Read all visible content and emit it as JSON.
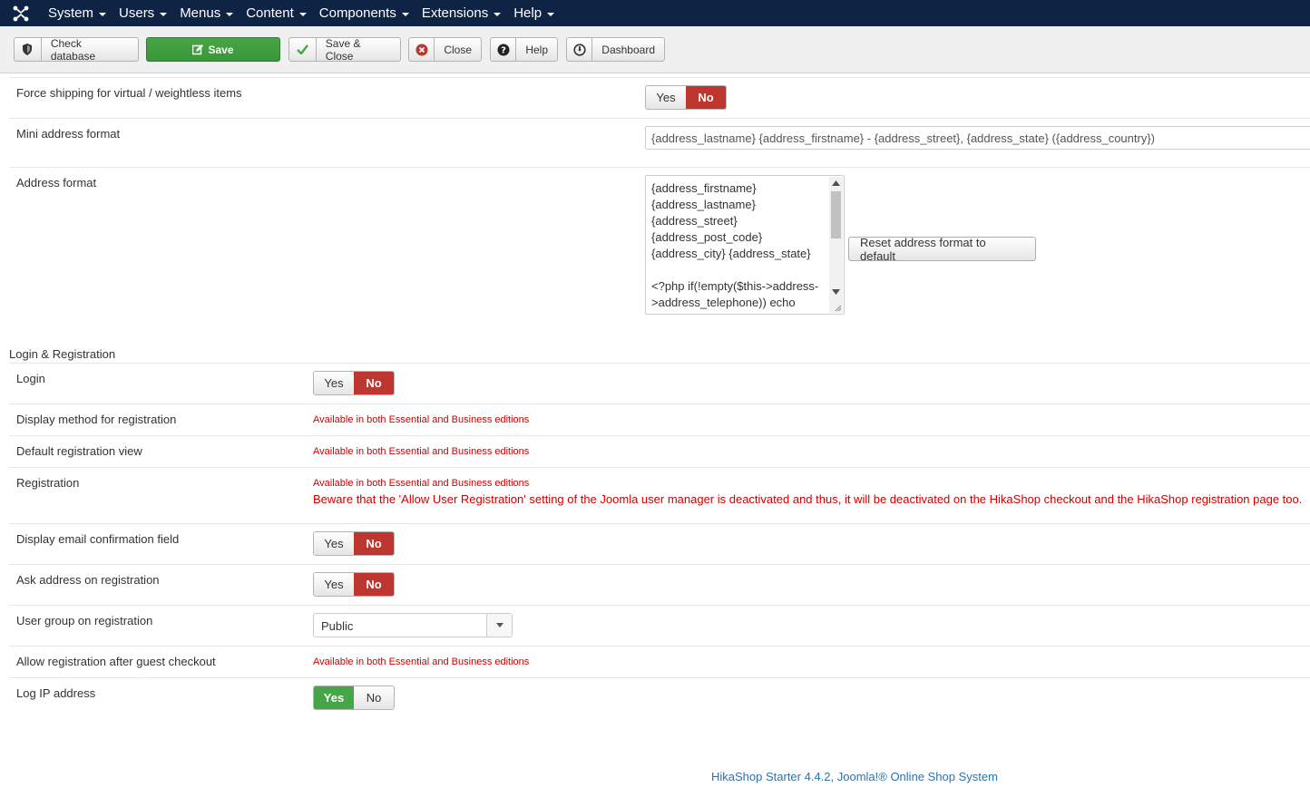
{
  "navbar": {
    "logo_icon": "joomla-logo-icon",
    "items": [
      {
        "label": "System"
      },
      {
        "label": "Users"
      },
      {
        "label": "Menus"
      },
      {
        "label": "Content"
      },
      {
        "label": "Components"
      },
      {
        "label": "Extensions"
      },
      {
        "label": "Help"
      }
    ]
  },
  "toolbar": {
    "check_database": "Check database",
    "save": "Save",
    "save_close": "Save & Close",
    "close": "Close",
    "help": "Help",
    "dashboard": "Dashboard"
  },
  "shipping": {
    "force_shipping": {
      "label": "Force shipping for virtual / weightless items",
      "yes": "Yes",
      "no": "No",
      "value": "No"
    },
    "mini_address": {
      "label": "Mini address format",
      "value": "{address_lastname} {address_firstname} - {address_street}, {address_state} ({address_country})"
    },
    "address_format": {
      "label": "Address format",
      "value": "{address_firstname}\n{address_lastname}\n{address_street}\n{address_post_code}\n{address_city} {address_state}\n\n<?php if(!empty($this->address->address_telephone)) echo\nJText::sprintf('TELEPHONE_IN_ADDRESS',",
      "reset_button": "Reset address format to default"
    }
  },
  "login_registration": {
    "title": "Login & Registration",
    "availability_note": "Available in both Essential and Business editions",
    "login": {
      "label": "Login",
      "yes": "Yes",
      "no": "No",
      "value": "No"
    },
    "display_method": {
      "label": "Display method for registration"
    },
    "default_view": {
      "label": "Default registration view"
    },
    "registration": {
      "label": "Registration",
      "warning": "Beware that the 'Allow User Registration' setting of the Joomla user manager is deactivated and thus, it will be deactivated on the HikaShop checkout and the HikaShop registration page too."
    },
    "email_confirmation": {
      "label": "Display email confirmation field",
      "yes": "Yes",
      "no": "No",
      "value": "No"
    },
    "ask_address": {
      "label": "Ask address on registration",
      "yes": "Yes",
      "no": "No",
      "value": "No"
    },
    "user_group": {
      "label": "User group on registration",
      "value": "Public"
    },
    "after_guest": {
      "label": "Allow registration after guest checkout"
    },
    "log_ip": {
      "label": "Log IP address",
      "yes": "Yes",
      "no": "No",
      "value": "Yes"
    }
  },
  "footer": {
    "text": "HikaShop Starter 4.4.2, Joomla!® Online Shop System"
  },
  "colors": {
    "navbar": "#0f2345",
    "save_green": "#46a546",
    "no_red": "#bd362f",
    "warning_red": "#d00000",
    "footer_link": "#3071a9"
  }
}
